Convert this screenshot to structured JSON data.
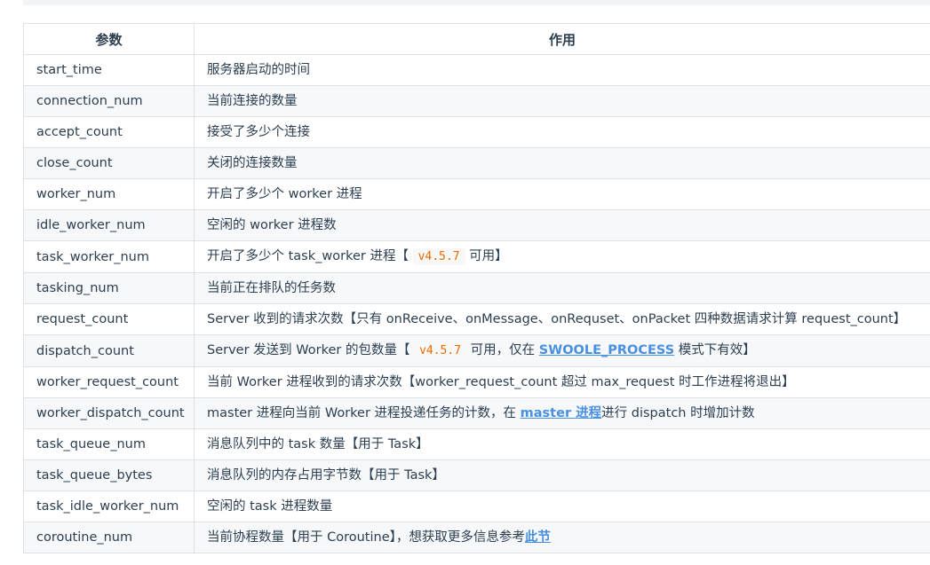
{
  "table": {
    "headers": [
      "参数",
      "作用"
    ],
    "rows": [
      {
        "name": "start_time",
        "desc": "服务器启动的时间"
      },
      {
        "name": "connection_num",
        "desc": "当前连接的数量"
      },
      {
        "name": "accept_count",
        "desc": "接受了多少个连接"
      },
      {
        "name": "close_count",
        "desc": "关闭的连接数量"
      },
      {
        "name": "worker_num",
        "desc": "开启了多少个 worker 进程"
      },
      {
        "name": "idle_worker_num",
        "desc": "空闲的 worker 进程数"
      },
      {
        "name": "task_worker_num",
        "desc_a": "开启了多少个 task_worker 进程【 ",
        "code": "v4.5.7",
        "desc_b": " 可用】"
      },
      {
        "name": "tasking_num",
        "desc": "当前正在排队的任务数"
      },
      {
        "name": "request_count",
        "desc": "Server 收到的请求次数【只有 onReceive、onMessage、onRequset、onPacket 四种数据请求计算 request_count】"
      },
      {
        "name": "dispatch_count",
        "desc_a": "Server 发送到 Worker 的包数量【 ",
        "code": "v4.5.7",
        "desc_b": " 可用，仅在 ",
        "link": "SWOOLE_PROCESS",
        "desc_c": " 模式下有效】"
      },
      {
        "name": "worker_request_count",
        "desc": "当前 Worker 进程收到的请求次数【worker_request_count 超过 max_request 时工作进程将退出】"
      },
      {
        "name": "worker_dispatch_count",
        "desc_a": "master 进程向当前 Worker 进程投递任务的计数，在 ",
        "link": "master 进程",
        "desc_b": "进行 dispatch 时增加计数"
      },
      {
        "name": "task_queue_num",
        "desc": "消息队列中的 task 数量【用于 Task】"
      },
      {
        "name": "task_queue_bytes",
        "desc": "消息队列的内存占用字节数【用于 Task】"
      },
      {
        "name": "task_idle_worker_num",
        "desc": "空闲的 task 进程数量"
      },
      {
        "name": "coroutine_num",
        "desc_a": "当前协程数量【用于 Coroutine】，想获取更多信息参考",
        "link": "此节"
      }
    ]
  }
}
